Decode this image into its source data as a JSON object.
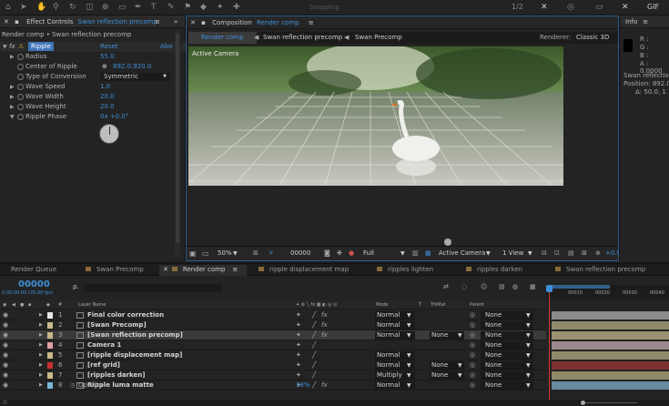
{
  "toolbar": {
    "icons": [
      "home-icon",
      "select-tool-icon",
      "hand-tool-icon",
      "zoom-tool-icon",
      "rotate-tool-icon",
      "camera-tool-icon",
      "pan-behind-icon",
      "rect-mask-icon",
      "pen-tool-icon",
      "type-tool-icon",
      "brush-tool-icon",
      "clone-stamp-icon",
      "eraser-icon",
      "roto-brush-icon",
      "puppet-pin-icon"
    ],
    "snapping": "Snapping",
    "right_labels": [
      "1/2",
      "GIF"
    ]
  },
  "effect_controls": {
    "tab_label": "Effect Controls",
    "tab_subject": "Swan reflection precomp",
    "breadcrumb": "Render comp • Swan reflection precomp",
    "effect_name": "Ripple",
    "reset": "Reset",
    "about": "Abo",
    "properties": [
      {
        "label": "Radius",
        "value": "55.0",
        "icon": "stopwatch"
      },
      {
        "label": "Center of Ripple",
        "value": "892.0,920.0",
        "icon": "stopwatch",
        "crosshair": true
      },
      {
        "label": "Type of Conversion",
        "value": "Symmetric",
        "icon": "stopwatch",
        "dropdown": true
      },
      {
        "label": "Wave Speed",
        "value": "1.0",
        "icon": "stopwatch"
      },
      {
        "label": "Wave Width",
        "value": "20.0",
        "icon": "stopwatch"
      },
      {
        "label": "Wave Height",
        "value": "20.0",
        "icon": "stopwatch"
      },
      {
        "label": "Ripple Phase",
        "value": "0x +0.0°",
        "icon": "stopwatch"
      }
    ]
  },
  "composition": {
    "tab_label": "Composition",
    "tab_subject": "Render comp",
    "flow": [
      "Render comp",
      "Swan reflection precomp",
      "Swan Precomp"
    ],
    "renderer_label": "Renderer:",
    "renderer_value": "Classic 3D",
    "active_camera_overlay": "Active Camera",
    "zoom": "50%",
    "timecode": "00000",
    "resolution": "Full",
    "camera": "Active Camera",
    "views": "1 View",
    "exposure": "+0.0"
  },
  "info": {
    "title": "Info",
    "r": "R :",
    "g": "G :",
    "b": "B :",
    "a": "A :  0.0000",
    "layer": "Swan reflection",
    "position": "Position: 892.0,",
    "delta": "Δ: 50.0, 1",
    "coord_x": "X :",
    "coord_y": "Y :"
  },
  "timeline": {
    "tabs": [
      {
        "label": "Render Queue",
        "color": "#00000000"
      },
      {
        "label": "Swan Precomp",
        "color": "#8a6a3a"
      },
      {
        "label": "Render comp",
        "color": "#8a6a3a",
        "active": true
      },
      {
        "label": "ripple displacement map",
        "color": "#8a6a3a"
      },
      {
        "label": "ripples lighten",
        "color": "#8a6a3a"
      },
      {
        "label": "ripples darken",
        "color": "#8a6a3a"
      },
      {
        "label": "Swan reflection precomp",
        "color": "#8a6a3a"
      }
    ],
    "current_time": "00000",
    "time_sub": "0:00:00:00 (25.00 fps)",
    "search_placeholder": "ρ.",
    "headers": {
      "num": "#",
      "layer_name": "Layer Name",
      "mode": "Mode",
      "t": "T",
      "trkmat": "TrkMat",
      "parent": "Parent"
    },
    "ruler": [
      "00010",
      "00020",
      "00030",
      "00040"
    ],
    "layers": [
      {
        "num": "1",
        "name": "Final color correction",
        "chip": "#e8e8e8",
        "mode": "Normal",
        "trkmat": "",
        "parent": "None",
        "bar": "#8d8a8a",
        "fx": true
      },
      {
        "num": "2",
        "name": "[Swan Precomp]",
        "chip": "#c9b88a",
        "mode": "Normal",
        "trkmat": "",
        "parent": "None",
        "bar": "#8f8a6a",
        "fx": true
      },
      {
        "num": "3",
        "name": "[Swan reflection precomp]",
        "chip": "#c9b88a",
        "mode": "Normal",
        "trkmat": "None",
        "parent": "None",
        "bar": "#9a9270",
        "fx": true,
        "selected": true
      },
      {
        "num": "4",
        "name": "Camera 1",
        "chip": "#e0a0a8",
        "mode": "",
        "trkmat": "",
        "parent": "None",
        "bar": "#9a8a8e"
      },
      {
        "num": "5",
        "name": "[ripple displacement map]",
        "chip": "#c9b88a",
        "mode": "Normal",
        "trkmat": "",
        "parent": "None",
        "bar": "#8f8a6a"
      },
      {
        "num": "6",
        "name": "[ref grid]",
        "chip": "#cc2f2f",
        "mode": "Normal",
        "trkmat": "None",
        "parent": "None",
        "bar": "#7d3232"
      },
      {
        "num": "7",
        "name": "[ripples darken]",
        "chip": "#c9b88a",
        "mode": "Multiply",
        "trkmat": "None",
        "parent": "None",
        "bar": "#8f8a6a"
      },
      {
        "num": "8",
        "name": "Ripple luma matte",
        "chip": "#7ab4d8",
        "mode": "Normal",
        "trkmat": "",
        "parent": "None",
        "bar": "#6a8aa0",
        "fx": true
      }
    ],
    "opacity_label": "Opacity",
    "opacity_value": "18%",
    "modes_label": "Toggle Switches / Modes"
  }
}
